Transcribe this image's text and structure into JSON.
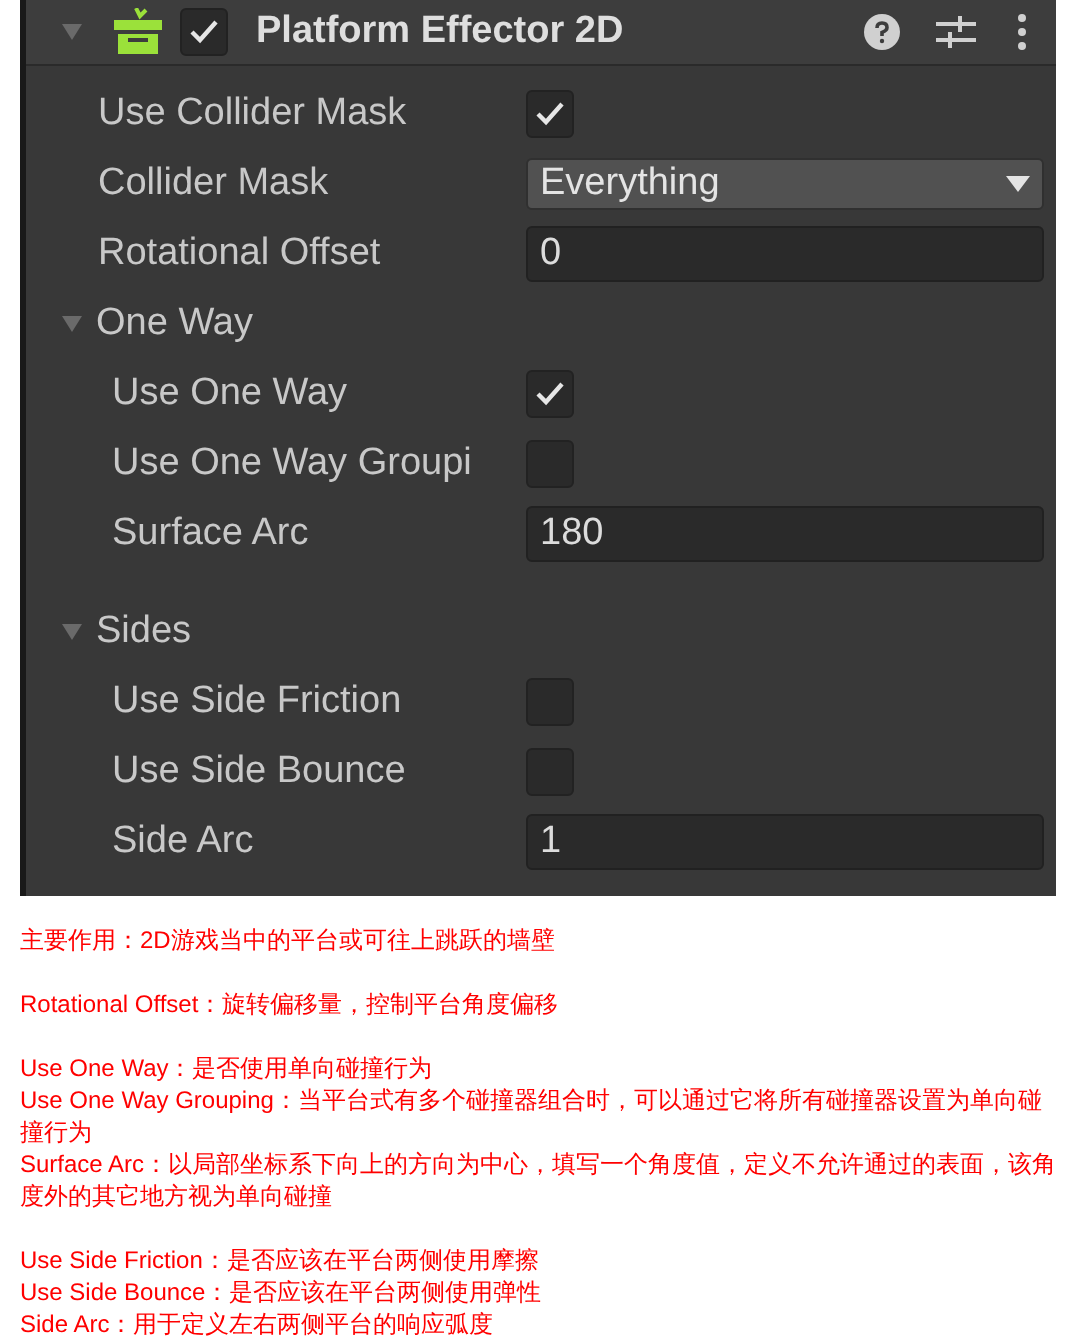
{
  "component": {
    "title": "Platform Effector 2D",
    "enabled": true,
    "expanded": true
  },
  "properties": [
    {
      "kind": "checkbox",
      "label": "Use Collider Mask",
      "checked": true
    },
    {
      "kind": "dropdown",
      "label": "Collider Mask",
      "value": "Everything"
    },
    {
      "kind": "number",
      "label": "Rotational Offset",
      "value": "0"
    },
    {
      "kind": "group",
      "label": "One Way",
      "expanded": true,
      "children": [
        {
          "kind": "checkbox",
          "label": "Use One Way",
          "checked": true
        },
        {
          "kind": "checkbox",
          "label": "Use One Way Groupi",
          "checked": false
        },
        {
          "kind": "number",
          "label": "Surface Arc",
          "value": "180"
        }
      ]
    },
    {
      "kind": "group",
      "label": "Sides",
      "expanded": true,
      "children": [
        {
          "kind": "checkbox",
          "label": "Use Side Friction",
          "checked": false
        },
        {
          "kind": "checkbox",
          "label": "Use Side Bounce",
          "checked": false
        },
        {
          "kind": "number",
          "label": "Side Arc",
          "value": "1"
        }
      ]
    }
  ],
  "notes": [
    [
      "主要作用：2D游戏当中的平台或可往上跳跃的墙壁"
    ],
    [
      "Rotational Offset：旋转偏移量，控制平台角度偏移"
    ],
    [
      "Use One Way：是否使用单向碰撞行为",
      "Use One Way Grouping：当平台式有多个碰撞器组合时，可以通过它将所有碰撞器设置为单向碰撞行为",
      "Surface Arc：以局部坐标系下向上的方向为中心，填写一个角度值，定义不允许通过的表面，该角度外的其它地方视为单向碰撞"
    ],
    [
      "Use Side Friction：是否应该在平台两侧使用摩擦",
      "Use Side Bounce：是否应该在平台两侧使用弹性",
      "Side Arc：用于定义左右两侧平台的响应弧度"
    ]
  ]
}
